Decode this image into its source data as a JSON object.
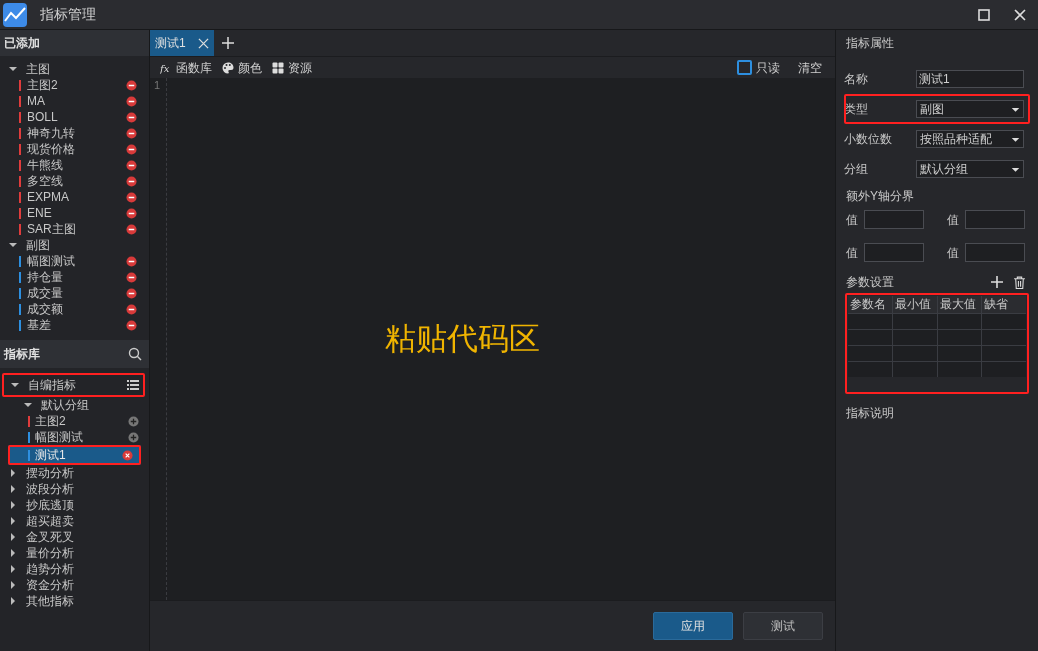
{
  "window": {
    "title": "指标管理"
  },
  "added": {
    "title": "已添加",
    "groups": [
      {
        "label": "主图",
        "expanded": true,
        "children": [
          {
            "label": "主图2",
            "color": "#e03c3c"
          },
          {
            "label": "MA",
            "color": "#e03c3c"
          },
          {
            "label": "BOLL",
            "color": "#e03c3c"
          },
          {
            "label": "神奇九转",
            "color": "#e03c3c"
          },
          {
            "label": "现货价格",
            "color": "#e03c3c"
          },
          {
            "label": "牛熊线",
            "color": "#e03c3c"
          },
          {
            "label": "多空线",
            "color": "#e03c3c"
          },
          {
            "label": "EXPMA",
            "color": "#e03c3c"
          },
          {
            "label": "ENE",
            "color": "#e03c3c"
          },
          {
            "label": "SAR主图",
            "color": "#e03c3c"
          }
        ]
      },
      {
        "label": "副图",
        "expanded": true,
        "children": [
          {
            "label": "幅图测试",
            "color": "#2d8fe0"
          },
          {
            "label": "持仓量",
            "color": "#2d8fe0"
          },
          {
            "label": "成交量",
            "color": "#2d8fe0"
          },
          {
            "label": "成交额",
            "color": "#2d8fe0"
          },
          {
            "label": "基差",
            "color": "#2d8fe0"
          }
        ]
      }
    ]
  },
  "library": {
    "title": "指标库",
    "groups": [
      {
        "label": "自编指标",
        "expanded": true,
        "highlighted": true,
        "children": [
          {
            "label": "默认分组",
            "expanded": true,
            "children": [
              {
                "label": "主图2",
                "color": "#e03c3c",
                "selected": false,
                "highlighted": false
              },
              {
                "label": "幅图测试",
                "color": "#2d8fe0",
                "selected": false,
                "highlighted": false
              },
              {
                "label": "测试1",
                "color": "#2d8fe0",
                "selected": true,
                "highlighted": true
              }
            ]
          }
        ]
      },
      {
        "label": "摆动分析",
        "expanded": false
      },
      {
        "label": "波段分析",
        "expanded": false
      },
      {
        "label": "抄底逃顶",
        "expanded": false
      },
      {
        "label": "超买超卖",
        "expanded": false
      },
      {
        "label": "金叉死叉",
        "expanded": false
      },
      {
        "label": "量价分析",
        "expanded": false
      },
      {
        "label": "趋势分析",
        "expanded": false
      },
      {
        "label": "资金分析",
        "expanded": false
      },
      {
        "label": "其他指标",
        "expanded": false
      }
    ]
  },
  "tabs": [
    {
      "label": "测试1",
      "selected": true
    }
  ],
  "toolbar": {
    "items": [
      {
        "kind": "fx",
        "label": "函数库"
      },
      {
        "kind": "palette",
        "label": "颜色"
      },
      {
        "kind": "grid",
        "label": "资源"
      }
    ],
    "readonly": {
      "label": "只读",
      "checked": false
    },
    "clear": "清空"
  },
  "editor": {
    "line_numbers": [
      "1"
    ],
    "hint": "粘贴代码区"
  },
  "buttons": [
    {
      "label": "应用",
      "primary": true
    },
    {
      "label": "测试",
      "primary": false
    }
  ],
  "properties": {
    "title": "指标属性",
    "fields": [
      {
        "kind": "input",
        "label": "名称",
        "value": "测试1",
        "highlighted": false
      },
      {
        "kind": "select",
        "label": "类型",
        "value": "副图",
        "highlighted": true
      },
      {
        "kind": "select",
        "label": "小数位数",
        "value": "按照品种适配",
        "highlighted": false
      },
      {
        "kind": "select",
        "label": "分组",
        "value": "默认分组",
        "highlighted": false
      }
    ],
    "y_axis": {
      "label": "额外Y轴分界",
      "values": [
        {
          "label": "值"
        },
        {
          "label": "值"
        },
        {
          "label": "值"
        },
        {
          "label": "值"
        }
      ]
    },
    "params": {
      "label": "参数设置",
      "columns": [
        "参数名",
        "最小值",
        "最大值",
        "缺省"
      ],
      "highlighted": true
    },
    "description": "指标说明"
  }
}
